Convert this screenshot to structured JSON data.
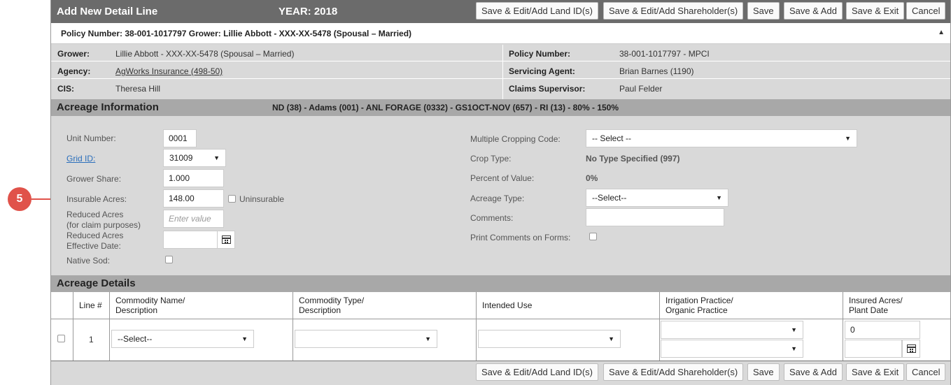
{
  "callout": "5",
  "header": {
    "title": "Add New Detail Line",
    "year": "YEAR: 2018",
    "buttons": [
      "Save & Edit/Add Land ID(s)",
      "Save & Edit/Add Shareholder(s)",
      "Save",
      "Save & Add",
      "Save & Exit",
      "Cancel"
    ]
  },
  "policy_bar": {
    "text": "Policy Number: 38-001-1017797 Grower: Lillie Abbott - XXX-XX-5478 (Spousal – Married)",
    "caret": "▲"
  },
  "info": {
    "grower_label": "Grower:",
    "grower": "Lillie Abbott - XXX-XX-5478 (Spousal – Married)",
    "policy_label": "Policy Number:",
    "policy": "38-001-1017797 - MPCI",
    "agency_label": "Agency:",
    "agency": "AgWorks Insurance (498-50)",
    "agent_label": "Servicing Agent:",
    "agent": "Brian Barnes (1190)",
    "cis_label": "CIS:",
    "cis": "Theresa Hill",
    "supervisor_label": "Claims Supervisor:",
    "supervisor": "Paul Felder"
  },
  "acreage_info": {
    "title": "Acreage Information",
    "subtitle": "ND (38) - Adams (001) - ANL FORAGE (0332) - GS1OCT-NOV (657) - RI (13) - 80% - 150%",
    "unit_number_label": "Unit Number:",
    "unit_number": "0001",
    "grid_id_label": "Grid ID:",
    "grid_id": "31009",
    "grower_share_label": "Grower Share:",
    "grower_share": "1.000",
    "insurable_acres_label": "Insurable Acres:",
    "insurable_acres": "148.00",
    "uninsurable_label": "Uninsurable",
    "reduced_acres_label_1": "Reduced Acres",
    "reduced_acres_label_2": "(for claim purposes)",
    "reduced_acres_placeholder": "Enter value",
    "reduced_date_label_1": "Reduced Acres",
    "reduced_date_label_2": "Effective Date:",
    "native_sod_label": "Native Sod:",
    "mcc_label": "Multiple Cropping Code:",
    "mcc": "-- Select --",
    "crop_type_label": "Crop Type:",
    "crop_type": "No Type Specified (997)",
    "percent_value_label": "Percent of Value:",
    "percent_value": "0%",
    "acreage_type_label": "Acreage Type:",
    "acreage_type": "--Select--",
    "comments_label": "Comments:",
    "print_comments_label": "Print Comments on Forms:"
  },
  "acreage_details": {
    "title": "Acreage Details",
    "columns": {
      "line": "Line #",
      "commodity_name_1": "Commodity Name/",
      "commodity_name_2": "Description",
      "commodity_type_1": "Commodity Type/",
      "commodity_type_2": "Description",
      "intended_use": "Intended Use",
      "irrigation_1": "Irrigation Practice/",
      "irrigation_2": "Organic Practice",
      "insured_1": "Insured Acres/",
      "insured_2": "Plant Date"
    },
    "row": {
      "line": "1",
      "commodity_name": "--Select--",
      "insured_acres": "0"
    }
  },
  "footer": {
    "buttons": [
      "Save & Edit/Add Land ID(s)",
      "Save & Edit/Add Shareholder(s)",
      "Save",
      "Save & Add",
      "Save & Exit",
      "Cancel"
    ]
  }
}
